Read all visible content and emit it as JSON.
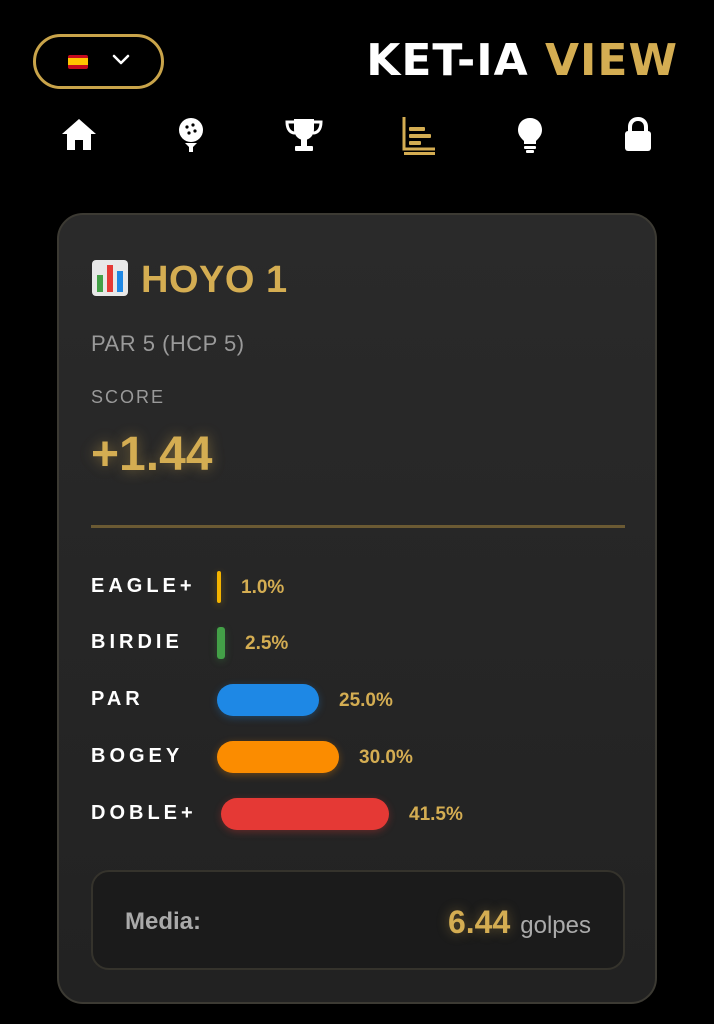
{
  "header": {
    "brand_part1": "KET-IA",
    "brand_part2": "VIEW",
    "language_flag": "flag-es-icon",
    "colors": {
      "accent": "#d4ad52",
      "background": "#000000"
    }
  },
  "nav": {
    "items": [
      {
        "name": "home",
        "icon": "home-icon",
        "active": false
      },
      {
        "name": "golf",
        "icon": "golf-ball-icon",
        "active": false
      },
      {
        "name": "trophy",
        "icon": "trophy-icon",
        "active": false
      },
      {
        "name": "stats",
        "icon": "bar-chart-icon",
        "active": true
      },
      {
        "name": "tips",
        "icon": "lightbulb-icon",
        "active": false
      },
      {
        "name": "lock",
        "icon": "lock-icon",
        "active": false
      }
    ]
  },
  "hole": {
    "title": "HOYO 1",
    "par_info": "PAR 5 (HCP 5)",
    "score_label": "SCORE",
    "score_value": "+1.44"
  },
  "distribution": [
    {
      "label": "EAGLE+",
      "pct": 1.0,
      "pct_text": "1.0%",
      "color": "#f4b400"
    },
    {
      "label": "BIRDIE",
      "pct": 2.5,
      "pct_text": "2.5%",
      "color": "#43a047"
    },
    {
      "label": "PAR",
      "pct": 25.0,
      "pct_text": "25.0%",
      "color": "#1e88e5"
    },
    {
      "label": "BOGEY",
      "pct": 30.0,
      "pct_text": "30.0%",
      "color": "#fb8c00"
    },
    {
      "label": "DOBLE+",
      "pct": 41.5,
      "pct_text": "41.5%",
      "color": "#e53935"
    }
  ],
  "average": {
    "label": "Media:",
    "value": "6.44",
    "unit": "golpes"
  }
}
